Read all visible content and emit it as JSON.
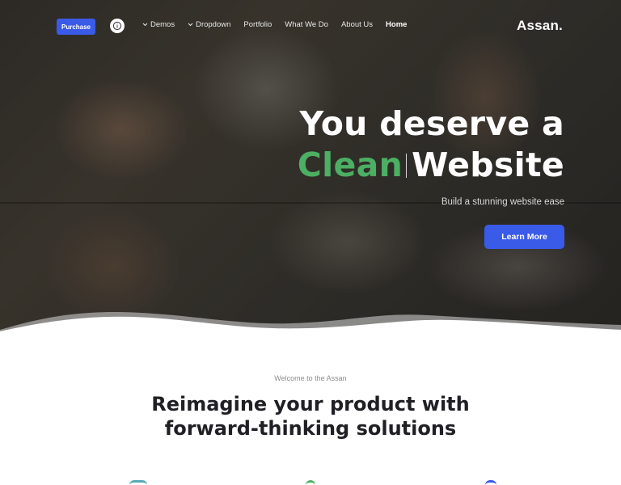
{
  "nav": {
    "purchase_label": "Purchase",
    "info_icon": "info-circle-icon",
    "items": [
      {
        "label": "Demos",
        "has_dropdown": true
      },
      {
        "label": "Dropdown",
        "has_dropdown": true
      },
      {
        "label": "Portfolio",
        "has_dropdown": false
      },
      {
        "label": "What We Do",
        "has_dropdown": false
      },
      {
        "label": "About Us",
        "has_dropdown": false
      },
      {
        "label": "Home",
        "has_dropdown": false,
        "active": true
      }
    ],
    "brand": "Assan."
  },
  "hero": {
    "headline_line1": "You deserve a",
    "headline_accent": "Clean",
    "headline_rest": "Website",
    "subtitle": "Build a stunning website ease",
    "cta_label": "Learn More"
  },
  "section": {
    "eyebrow": "Welcome to the Assan",
    "title_line1": "Reimagine your product with",
    "title_line2": "forward-thinking solutions"
  },
  "colors": {
    "primary": "#3a5ae8",
    "accent_green": "#4caf63",
    "heading": "#1f1f24",
    "muted": "#8e8e8e"
  }
}
